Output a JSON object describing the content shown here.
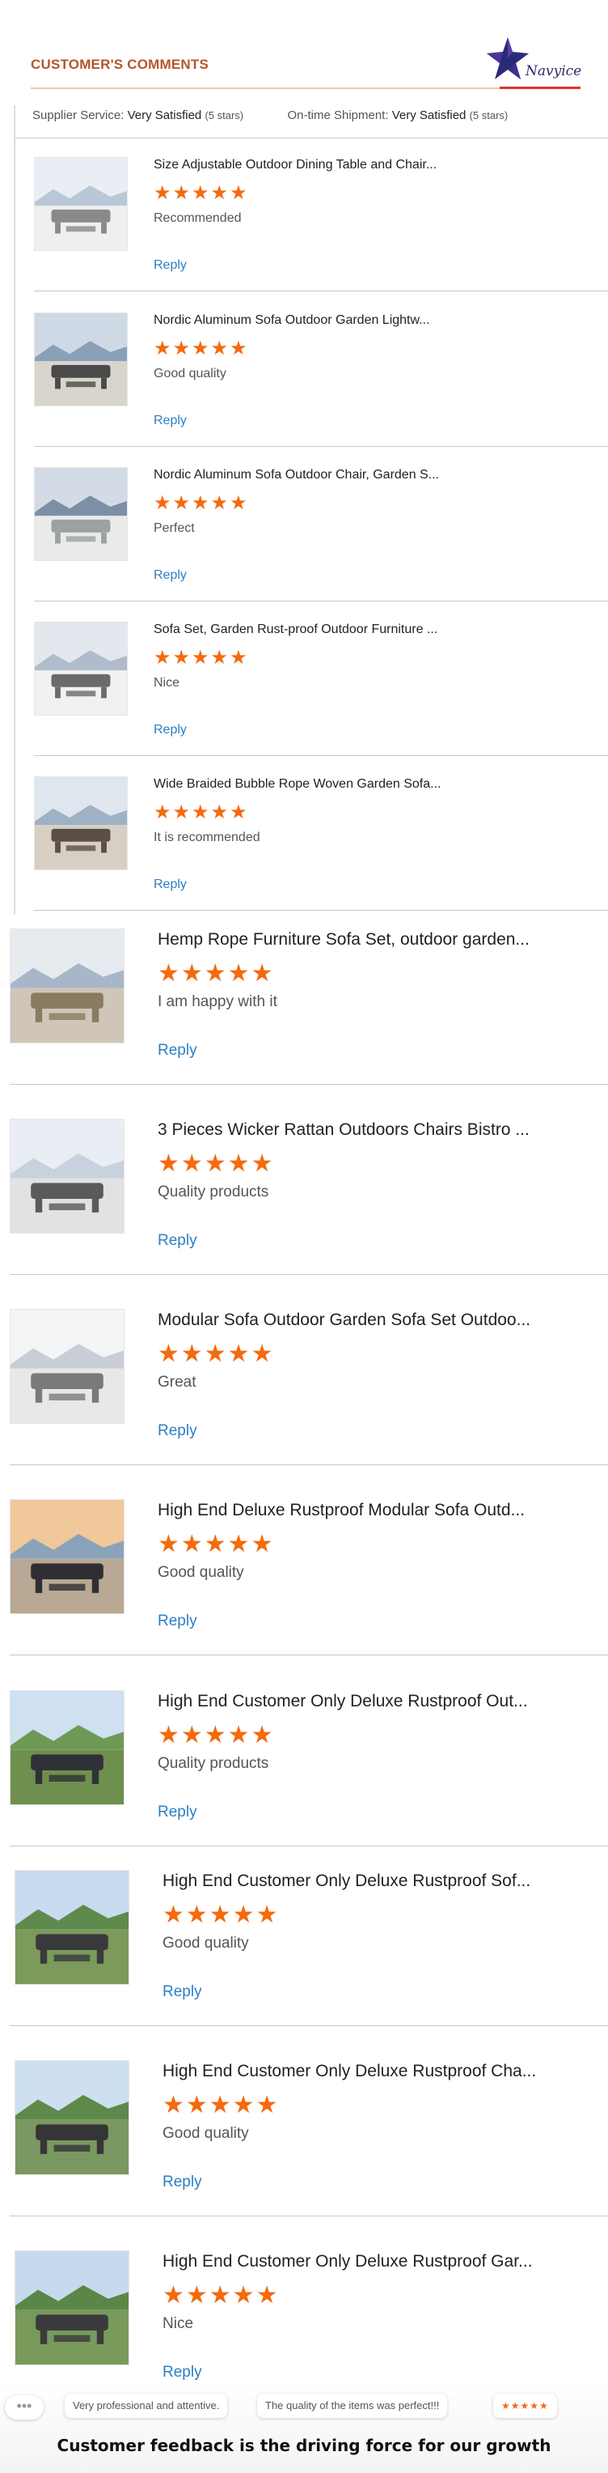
{
  "header": {
    "title": "CUSTOMER'S COMMENTS",
    "brand": "Navyice"
  },
  "summary": {
    "supplier_label": "Supplier Service:",
    "supplier_value": "Very Satisfied",
    "supplier_stars": "(5 stars)",
    "shipment_label": "On-time Shipment:",
    "shipment_value": "Very Satisfied",
    "shipment_stars": "(5 stars)"
  },
  "stars_glyph": "★★★★★",
  "reviews": [
    {
      "title": "Size Adjustable Outdoor Dining Table and Chair...",
      "comment": "Recommended",
      "reply": "Reply",
      "rating": 5
    },
    {
      "title": "Nordic Aluminum Sofa Outdoor Garden Lightw...",
      "comment": "Good quality",
      "reply": "Reply",
      "rating": 5
    },
    {
      "title": "Nordic Aluminum Sofa Outdoor Chair, Garden S...",
      "comment": "Perfect",
      "reply": "Reply",
      "rating": 5
    },
    {
      "title": "Sofa Set, Garden Rust-proof Outdoor Furniture ...",
      "comment": "Nice",
      "reply": "Reply",
      "rating": 5
    },
    {
      "title": "Wide Braided Bubble Rope Woven Garden Sofa...",
      "comment": "It is recommended",
      "reply": "Reply",
      "rating": 5
    },
    {
      "title": "Hemp Rope Furniture Sofa Set, outdoor garden...",
      "comment": "I am happy with it",
      "reply": "Reply",
      "rating": 5
    },
    {
      "title": "3 Pieces Wicker Rattan Outdoors Chairs Bistro ...",
      "comment": "Quality products",
      "reply": "Reply",
      "rating": 5
    },
    {
      "title": "Modular Sofa Outdoor Garden Sofa Set Outdoo...",
      "comment": "Great",
      "reply": "Reply",
      "rating": 5
    },
    {
      "title": "High End Deluxe Rustproof Modular Sofa Outd...",
      "comment": "Good quality",
      "reply": "Reply",
      "rating": 5
    },
    {
      "title": "High End Customer Only Deluxe Rustproof Out...",
      "comment": "Quality products",
      "reply": "Reply",
      "rating": 5
    },
    {
      "title": "High End Customer Only Deluxe Rustproof Sof...",
      "comment": "Good quality",
      "reply": "Reply",
      "rating": 5
    },
    {
      "title": "High End Customer Only Deluxe Rustproof Cha...",
      "comment": "Good quality",
      "reply": "Reply",
      "rating": 5
    },
    {
      "title": "High End Customer Only Deluxe Rustproof Gar...",
      "comment": "Nice",
      "reply": "Reply",
      "rating": 5
    }
  ],
  "footer": {
    "more_icon": "more-dots-icon",
    "chip_1": "Very professional and attentive.",
    "chip_2": "The quality of the items was perfect!!!",
    "chip_3_stars": "★★★★★",
    "tagline": "Customer feedback is the driving force for our growth"
  },
  "colors": {
    "accent": "#b5552a",
    "star": "#f46a0e",
    "link": "#2b7fc6",
    "rule_accent": "#dd3333"
  }
}
